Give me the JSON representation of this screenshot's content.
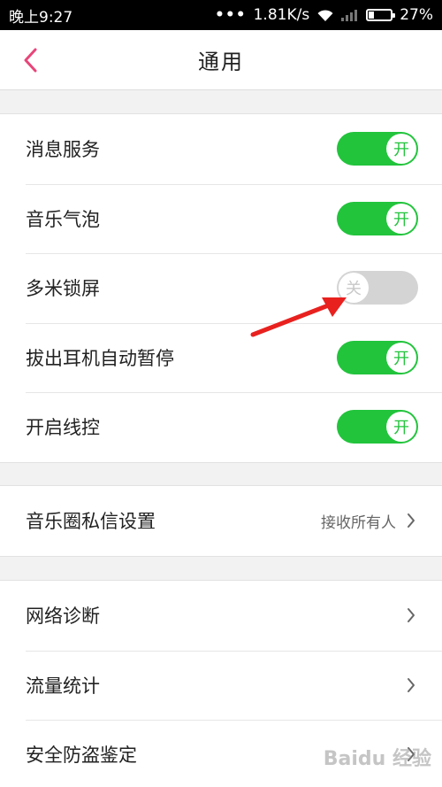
{
  "status_bar": {
    "time": "晚上9:27",
    "dots": "•••",
    "speed": "1.81K/s",
    "battery": "27%"
  },
  "nav": {
    "title": "通用"
  },
  "toggles": [
    {
      "label": "消息服务",
      "state": "开",
      "on": true
    },
    {
      "label": "音乐气泡",
      "state": "开",
      "on": true
    },
    {
      "label": "多米锁屏",
      "state": "关",
      "on": false
    },
    {
      "label": "拔出耳机自动暂停",
      "state": "开",
      "on": true
    },
    {
      "label": "开启线控",
      "state": "开",
      "on": true
    }
  ],
  "privacy": {
    "label": "音乐圈私信设置",
    "value": "接收所有人"
  },
  "tools": [
    {
      "label": "网络诊断"
    },
    {
      "label": "流量统计"
    },
    {
      "label": "安全防盗鉴定"
    }
  ],
  "watermark": "Baidu 经验",
  "colors": {
    "accent": "#e8457a",
    "toggle_on": "#22c43c",
    "toggle_off": "#d4d4d4",
    "annotation_arrow": "#e8211f"
  }
}
